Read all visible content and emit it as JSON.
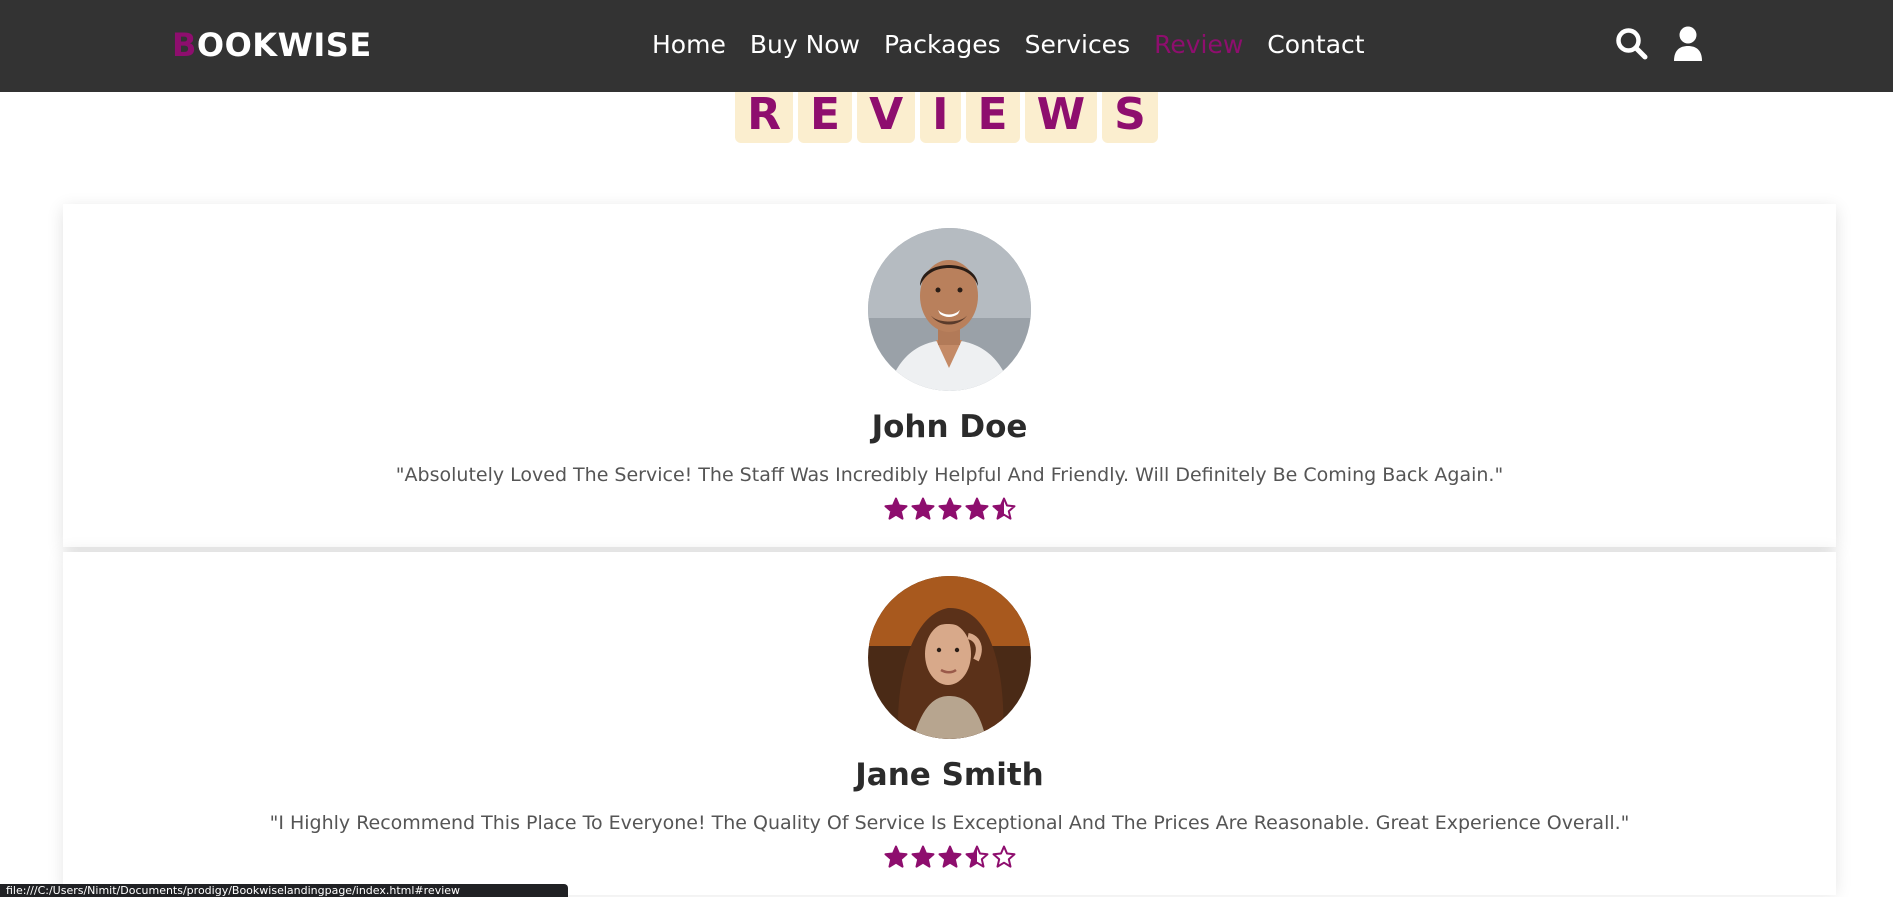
{
  "header": {
    "logo_first": "B",
    "logo_rest": "OOKWISE",
    "nav": [
      "Home",
      "Buy Now",
      "Packages",
      "Services",
      "Review",
      "Contact"
    ],
    "active_nav": "Review",
    "icons": [
      "search-icon",
      "user-icon"
    ]
  },
  "section": {
    "title_letters": [
      "R",
      "E",
      "V",
      "I",
      "E",
      "W",
      "S"
    ]
  },
  "reviews": [
    {
      "name": "John Doe",
      "quote": "\"Absolutely Loved The Service! The Staff Was Incredibly Helpful And Friendly. Will Definitely Be Coming Back Again.\"",
      "rating": 4.5
    },
    {
      "name": "Jane Smith",
      "quote": "\"I Highly Recommend This Place To Everyone! The Quality Of Service Is Exceptional And The Prices Are Reasonable. Great Experience Overall.\"",
      "rating": 3.5
    }
  ],
  "status_bar": {
    "url": "file:///C:/Users/Nimit/Documents/prodigy/Bookwiselandingpage/index.html#review"
  },
  "colors": {
    "accent": "#8e0e6e",
    "header_bg": "#333333",
    "title_tile_bg": "#fbeecf"
  }
}
